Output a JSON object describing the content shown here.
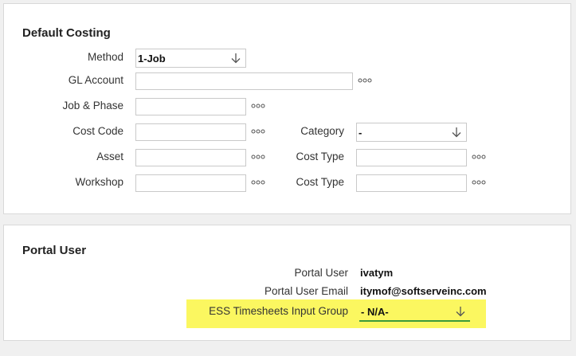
{
  "costing": {
    "title": "Default Costing",
    "method": {
      "label": "Method",
      "value": "1-Job"
    },
    "gl_account": {
      "label": "GL Account",
      "value": ""
    },
    "job_phase": {
      "label": "Job & Phase",
      "value": ""
    },
    "cost_code": {
      "label": "Cost Code",
      "value": ""
    },
    "asset": {
      "label": "Asset",
      "value": ""
    },
    "workshop": {
      "label": "Workshop",
      "value": ""
    },
    "category": {
      "label": "Category",
      "value": "-"
    },
    "cost_type_1": {
      "label": "Cost Type",
      "value": ""
    },
    "cost_type_2": {
      "label": "Cost Type",
      "value": ""
    }
  },
  "portal": {
    "title": "Portal User",
    "portal_user": {
      "label": "Portal User",
      "value": "ivatym"
    },
    "portal_user_email": {
      "label": "Portal User Email",
      "value": "itymof@softserveinc.com"
    },
    "ess_group": {
      "label": "ESS Timesheets Input Group",
      "value": "- N/A-"
    }
  },
  "colors": {
    "highlight": "#fbf760",
    "underline": "#3c9a3c",
    "border": "#c9c9c9"
  },
  "icons": {
    "dropdown": "arrow-down-icon",
    "lookup": "ellipsis-icon"
  }
}
